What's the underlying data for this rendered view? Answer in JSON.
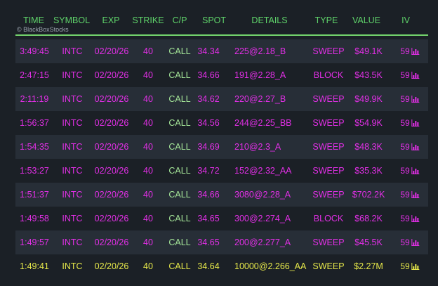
{
  "watermark": "© BlackBoxStocks",
  "columns": [
    "TIME",
    "SYMBOL",
    "EXP",
    "STRIKE",
    "C/P",
    "SPOT",
    "DETAILS",
    "TYPE",
    "VALUE",
    "IV"
  ],
  "colors": {
    "header": "#5fd36a",
    "magenta": "#e22fe6",
    "call_green": "#a4e598",
    "highlight_yellow": "#e6e84a",
    "row_alt": "#272e37",
    "background": "#1b2026"
  },
  "icons": {
    "iv": "bar-chart-icon"
  },
  "rows": [
    {
      "time": "3:49:45",
      "symbol": "INTC",
      "exp": "02/20/26",
      "strike": "40",
      "cp": "CALL",
      "spot": "34.34",
      "details": "225@2.18_B",
      "type": "SWEEP",
      "value": "$49.1K",
      "iv": "59",
      "style": "magenta"
    },
    {
      "time": "2:47:15",
      "symbol": "INTC",
      "exp": "02/20/26",
      "strike": "40",
      "cp": "CALL",
      "spot": "34.66",
      "details": "191@2.28_A",
      "type": "BLOCK",
      "value": "$43.5K",
      "iv": "59",
      "style": "magenta"
    },
    {
      "time": "2:11:19",
      "symbol": "INTC",
      "exp": "02/20/26",
      "strike": "40",
      "cp": "CALL",
      "spot": "34.62",
      "details": "220@2.27_B",
      "type": "SWEEP",
      "value": "$49.9K",
      "iv": "59",
      "style": "magenta"
    },
    {
      "time": "1:56:37",
      "symbol": "INTC",
      "exp": "02/20/26",
      "strike": "40",
      "cp": "CALL",
      "spot": "34.56",
      "details": "244@2.25_BB",
      "type": "SWEEP",
      "value": "$54.9K",
      "iv": "59",
      "style": "magenta"
    },
    {
      "time": "1:54:35",
      "symbol": "INTC",
      "exp": "02/20/26",
      "strike": "40",
      "cp": "CALL",
      "spot": "34.69",
      "details": "210@2.3_A",
      "type": "SWEEP",
      "value": "$48.3K",
      "iv": "59",
      "style": "magenta"
    },
    {
      "time": "1:53:27",
      "symbol": "INTC",
      "exp": "02/20/26",
      "strike": "40",
      "cp": "CALL",
      "spot": "34.72",
      "details": "152@2.32_AA",
      "type": "SWEEP",
      "value": "$35.3K",
      "iv": "59",
      "style": "magenta"
    },
    {
      "time": "1:51:37",
      "symbol": "INTC",
      "exp": "02/20/26",
      "strike": "40",
      "cp": "CALL",
      "spot": "34.66",
      "details": "3080@2.28_A",
      "type": "SWEEP",
      "value": "$702.2K",
      "iv": "59",
      "style": "magenta"
    },
    {
      "time": "1:49:58",
      "symbol": "INTC",
      "exp": "02/20/26",
      "strike": "40",
      "cp": "CALL",
      "spot": "34.65",
      "details": "300@2.274_A",
      "type": "BLOCK",
      "value": "$68.2K",
      "iv": "59",
      "style": "magenta"
    },
    {
      "time": "1:49:57",
      "symbol": "INTC",
      "exp": "02/20/26",
      "strike": "40",
      "cp": "CALL",
      "spot": "34.65",
      "details": "200@2.277_A",
      "type": "SWEEP",
      "value": "$45.5K",
      "iv": "59",
      "style": "magenta"
    },
    {
      "time": "1:49:41",
      "symbol": "INTC",
      "exp": "02/20/26",
      "strike": "40",
      "cp": "CALL",
      "spot": "34.64",
      "details": "10000@2.266_AA",
      "type": "SWEEP",
      "value": "$2.27M",
      "iv": "59",
      "style": "yellow"
    }
  ]
}
